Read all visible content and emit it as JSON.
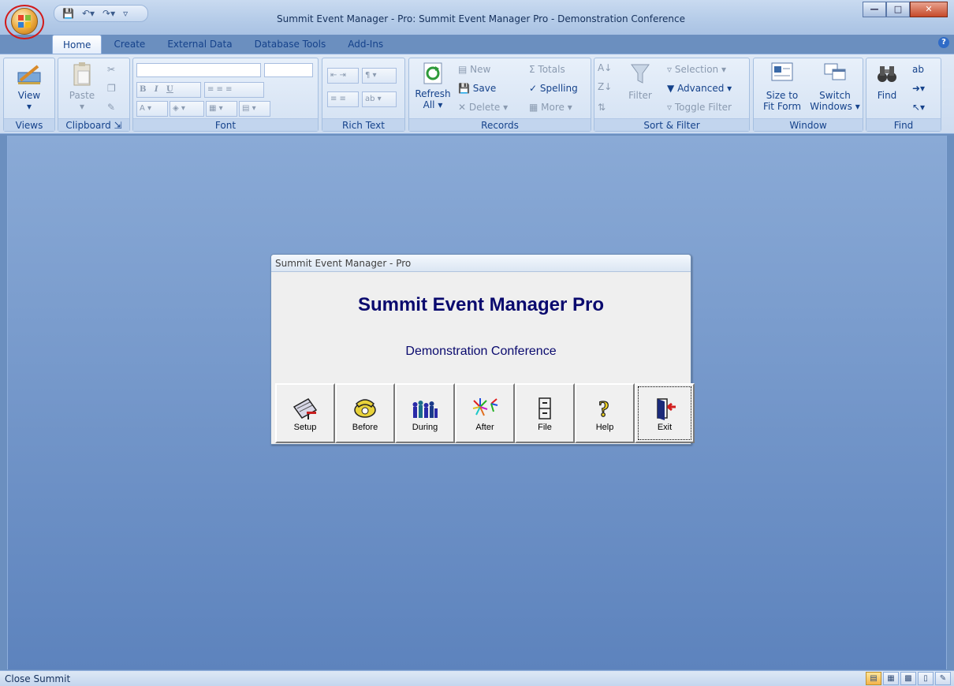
{
  "window": {
    "title": "Summit Event Manager - Pro: Summit Event Manager Pro - Demonstration Conference",
    "controls": [
      "minimize-icon",
      "maximize-icon",
      "close-icon"
    ]
  },
  "qat": {
    "items": [
      "save-icon",
      "undo-icon",
      "redo-icon",
      "customize-icon"
    ]
  },
  "tabs": [
    {
      "label": "Home",
      "active": true
    },
    {
      "label": "Create"
    },
    {
      "label": "External Data"
    },
    {
      "label": "Database Tools"
    },
    {
      "label": "Add-Ins"
    }
  ],
  "ribbon": {
    "views": {
      "name": "Views",
      "view_label": "View"
    },
    "clipboard": {
      "name": "Clipboard",
      "paste_label": "Paste"
    },
    "font": {
      "name": "Font",
      "bold": "B",
      "italic": "I",
      "underline": "U"
    },
    "richtext": {
      "name": "Rich Text"
    },
    "records": {
      "name": "Records",
      "refresh_label": "Refresh",
      "refresh_sub": "All",
      "new": "New",
      "save": "Save",
      "delete": "Delete",
      "totals": "Totals",
      "spelling": "Spelling",
      "more": "More"
    },
    "sortfilter": {
      "name": "Sort & Filter",
      "filter": "Filter",
      "selection": "Selection",
      "advanced": "Advanced",
      "toggle": "Toggle Filter"
    },
    "window": {
      "name": "Window",
      "size_line1": "Size to",
      "size_line2": "Fit Form",
      "switch_line1": "Switch",
      "switch_line2": "Windows"
    },
    "find": {
      "name": "Find",
      "find_label": "Find"
    }
  },
  "dialog": {
    "title": "Summit Event Manager - Pro",
    "heading": "Summit Event Manager Pro",
    "subheading": "Demonstration Conference",
    "buttons": [
      {
        "label": "Setup",
        "icon": "setup-icon"
      },
      {
        "label": "Before",
        "icon": "phone-icon"
      },
      {
        "label": "During",
        "icon": "crowd-icon"
      },
      {
        "label": "After",
        "icon": "fireworks-icon"
      },
      {
        "label": "File",
        "icon": "file-cabinet-icon"
      },
      {
        "label": "Help",
        "icon": "question-icon"
      },
      {
        "label": "Exit",
        "icon": "exit-door-icon"
      }
    ]
  },
  "statusbar": {
    "text": "Close  Summit"
  }
}
